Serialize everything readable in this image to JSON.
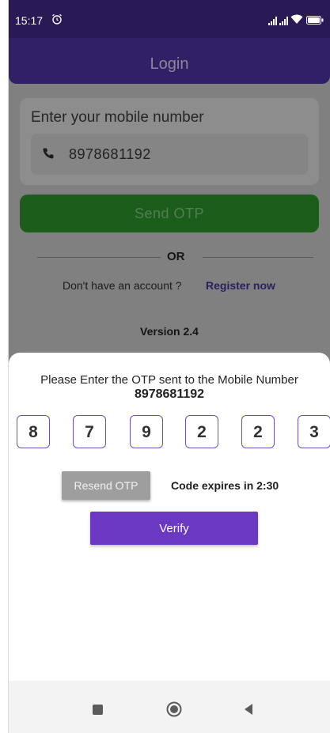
{
  "status_bar": {
    "time": "15:17",
    "icons": [
      "alarm-icon",
      "signal-icon",
      "wifi-icon",
      "battery-icon"
    ]
  },
  "app_bar": {
    "title": "Login"
  },
  "login_form": {
    "mobile_label": "Enter your mobile number",
    "phone_icon": "phone-icon",
    "mobile_value": "8978681192",
    "send_otp_label": "Send OTP",
    "or_text": "OR",
    "account_text": "Don't have an account ?",
    "register_label": "Register now",
    "version_text": "Version 2.4"
  },
  "otp_sheet": {
    "prompt": "Please Enter the OTP sent to the Mobile Number",
    "mobile_number": "8978681192",
    "digits": [
      "8",
      "7",
      "9",
      "2",
      "2",
      "3"
    ],
    "resend_label": "Resend OTP",
    "expiry_text": "Code expires in 2:30",
    "verify_label": "Verify"
  },
  "nav_bar": {
    "icons": [
      "recent-apps-icon",
      "home-icon",
      "back-icon"
    ]
  },
  "colors": {
    "primary": "#6a38c2",
    "app_bar": "#312066",
    "send_button": "#1c5d1c",
    "otp_border": "#6a4fc0"
  }
}
